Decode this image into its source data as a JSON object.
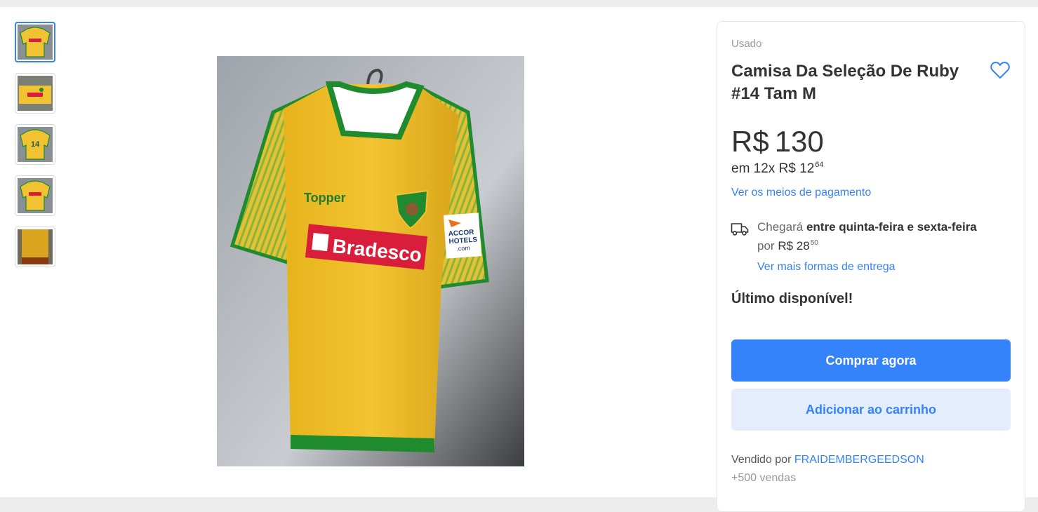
{
  "gallery": {
    "thumbnails": [
      {
        "name": "thumbnail-1",
        "active": true
      },
      {
        "name": "thumbnail-2",
        "active": false
      },
      {
        "name": "thumbnail-3",
        "active": false
      },
      {
        "name": "thumbnail-4",
        "active": false
      },
      {
        "name": "thumbnail-5",
        "active": false
      }
    ],
    "jersey_brand": "Topper",
    "jersey_sponsor": "Bradesco",
    "jersey_sleeve_sponsor": [
      "ACCOR",
      "HOTELS",
      ".com"
    ]
  },
  "product": {
    "condition": "Usado",
    "title": "Camisa Da Seleção De Ruby #14 Tam M",
    "price_currency": "R$",
    "price_value": "130",
    "installments_prefix": "em 12x R$ 12",
    "installments_cents": "64",
    "payment_link": "Ver os meios de pagamento"
  },
  "shipping": {
    "icon": "truck-icon",
    "arrival_prefix": "Chegará",
    "arrival_window": "entre quinta-feira e sexta-feira",
    "cost_prefix": "por",
    "cost_value": "R$ 28",
    "cost_cents": "50",
    "more_link": "Ver mais formas de entrega"
  },
  "stock": {
    "label": "Último disponível!"
  },
  "actions": {
    "buy_label": "Comprar agora",
    "cart_label": "Adicionar ao carrinho"
  },
  "seller": {
    "prefix": "Vendido por",
    "name": "FRAIDEMBERGEEDSON",
    "sales": "+500 vendas"
  },
  "colors": {
    "accent": "#3483fa",
    "accent_light": "#e3edfb",
    "jersey_yellow": "#f1c232",
    "jersey_green": "#1f8a2e",
    "sponsor_red": "#d81e3b"
  }
}
